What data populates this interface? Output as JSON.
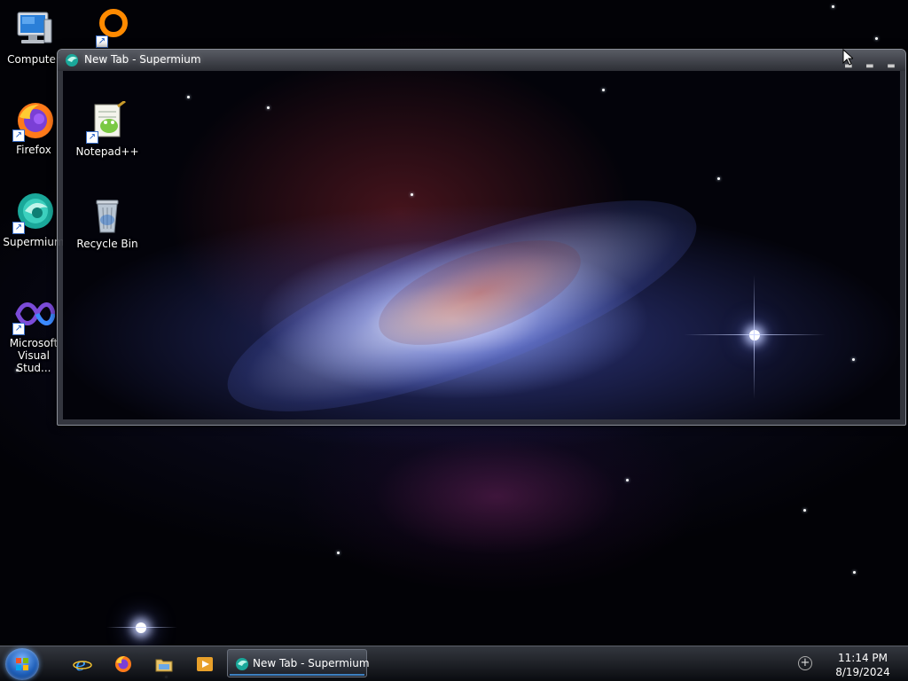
{
  "desktop": {
    "icons": [
      {
        "label": "Computer",
        "icon": "computer-icon"
      },
      {
        "label": "",
        "icon": "orange-ring-app-icon"
      },
      {
        "label": "Firefox",
        "icon": "firefox-icon"
      },
      {
        "label": "Supermium",
        "icon": "supermium-icon"
      },
      {
        "label": "Microsoft\nVisual Stud...",
        "icon": "visual-studio-icon"
      }
    ]
  },
  "window": {
    "title": "New Tab - Supermium",
    "content_icons": [
      {
        "label": "Notepad++",
        "icon": "notepad-plus-plus-icon"
      },
      {
        "label": "Recycle Bin",
        "icon": "recycle-bin-icon"
      }
    ]
  },
  "taskbar": {
    "start_icon": "windows-start-orb-icon",
    "quick_launch": [
      "internet-explorer-icon",
      "firefox-icon",
      "file-explorer-icon",
      "media-player-icon"
    ],
    "active_task_label": "New Tab - Supermium",
    "clock_time": "11:14 PM",
    "clock_date": "8/19/2024"
  },
  "colors": {
    "accent": "#4aa8ff",
    "start_orb": "#1f5fb8",
    "titlebar_text": "#ffffff"
  }
}
